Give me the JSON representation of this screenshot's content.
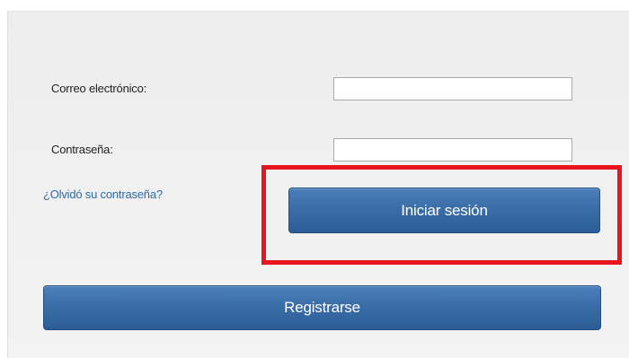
{
  "login_form": {
    "email_label": "Correo electrónico:",
    "email_value": "",
    "password_label": "Contraseña:",
    "password_value": "",
    "forgot_password_link": "¿Olvidó su contraseña?",
    "login_button": "Iniciar sesión",
    "register_button": "Registrarse"
  },
  "colors": {
    "panel_background": "#ededed",
    "link": "#2d6aa7",
    "button": "#3b6ea8",
    "highlight": "#e8141e"
  }
}
